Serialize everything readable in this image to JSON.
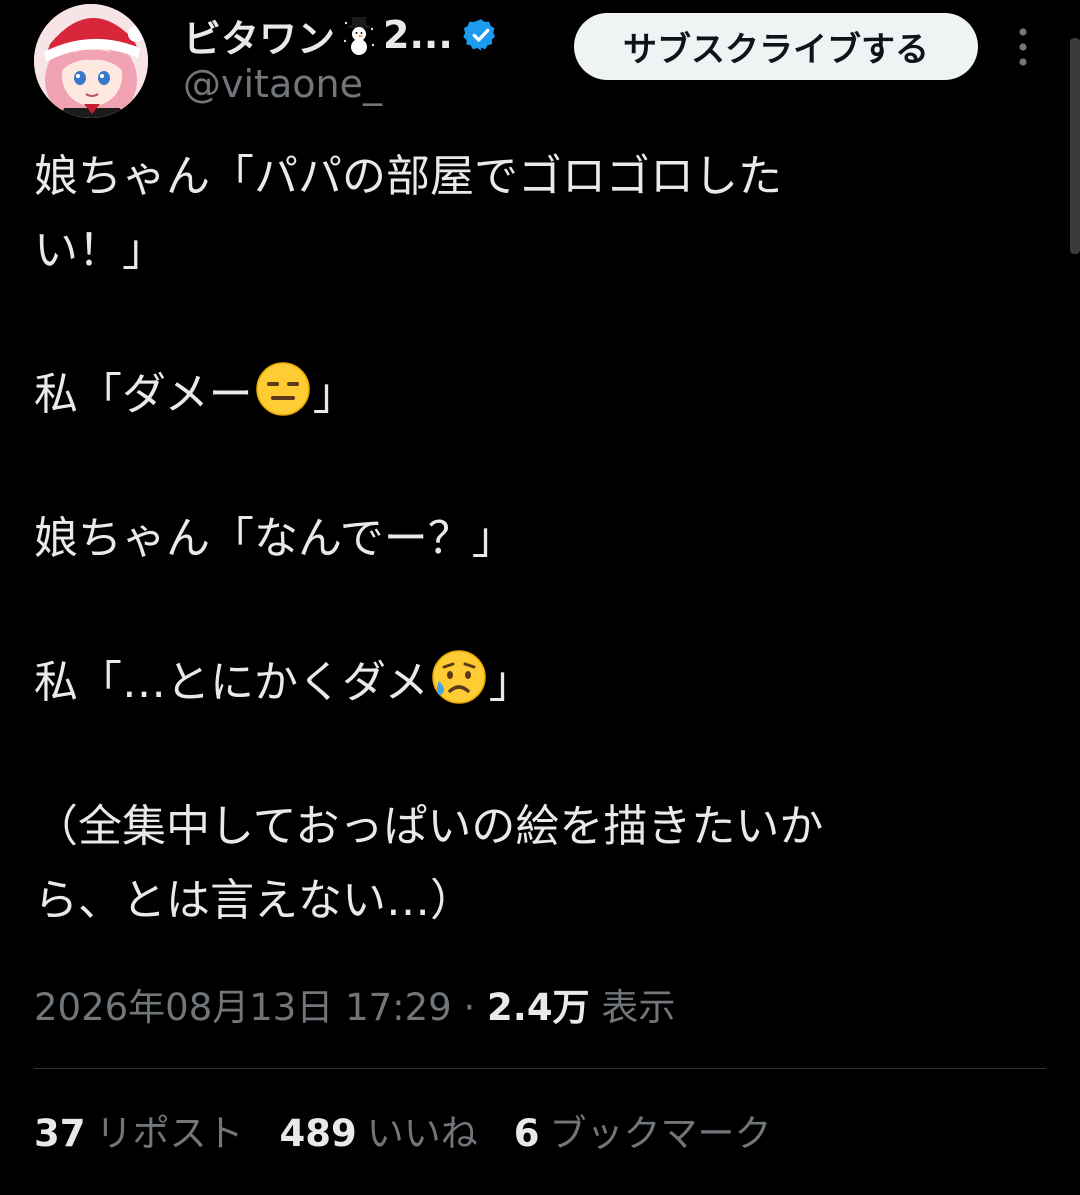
{
  "header": {
    "display_name": "ビタワン",
    "name_ellipsis": "2...",
    "handle": "@vitaone_",
    "subscribe_label": "サブスクライブする",
    "verified_color": "#1d9bf0",
    "avatar_icon": "anime-girl-santa-hat-avatar",
    "name_emoji": "snowman-icon",
    "more_icon": "vertical-dots-icon"
  },
  "tweet": {
    "lines": [
      {
        "pre": "娘ちゃん「パパの部屋でゴロゴロした",
        "post": ""
      },
      {
        "pre": "い！」",
        "post": ""
      },
      {
        "pre": "私「ダメー",
        "emoji": "expressionless-face",
        "post": "」"
      },
      {
        "pre": "娘ちゃん「なんでー？」",
        "post": ""
      },
      {
        "pre": "私「…とにかくダメ",
        "emoji": "anxious-face-with-sweat",
        "post": "」"
      },
      {
        "pre": "（全集中しておっぱいの絵を描きたいか",
        "post": ""
      },
      {
        "pre": "ら、とは言えない…）",
        "post": ""
      }
    ]
  },
  "meta": {
    "timestamp": "2026年08月13日 17:29",
    "separator": " · ",
    "views_count": "2.4万",
    "views_label": " 表示"
  },
  "stats": {
    "reposts_count": "37",
    "reposts_label": "リポスト",
    "likes_count": "489",
    "likes_label": "いいね",
    "bookmarks_count": "6",
    "bookmarks_label": "ブックマーク"
  },
  "colors": {
    "background": "#000000",
    "text_primary": "#e7e9ea",
    "text_secondary": "#71767b",
    "button_bg": "#eff3f4",
    "divider": "#2f3336"
  }
}
